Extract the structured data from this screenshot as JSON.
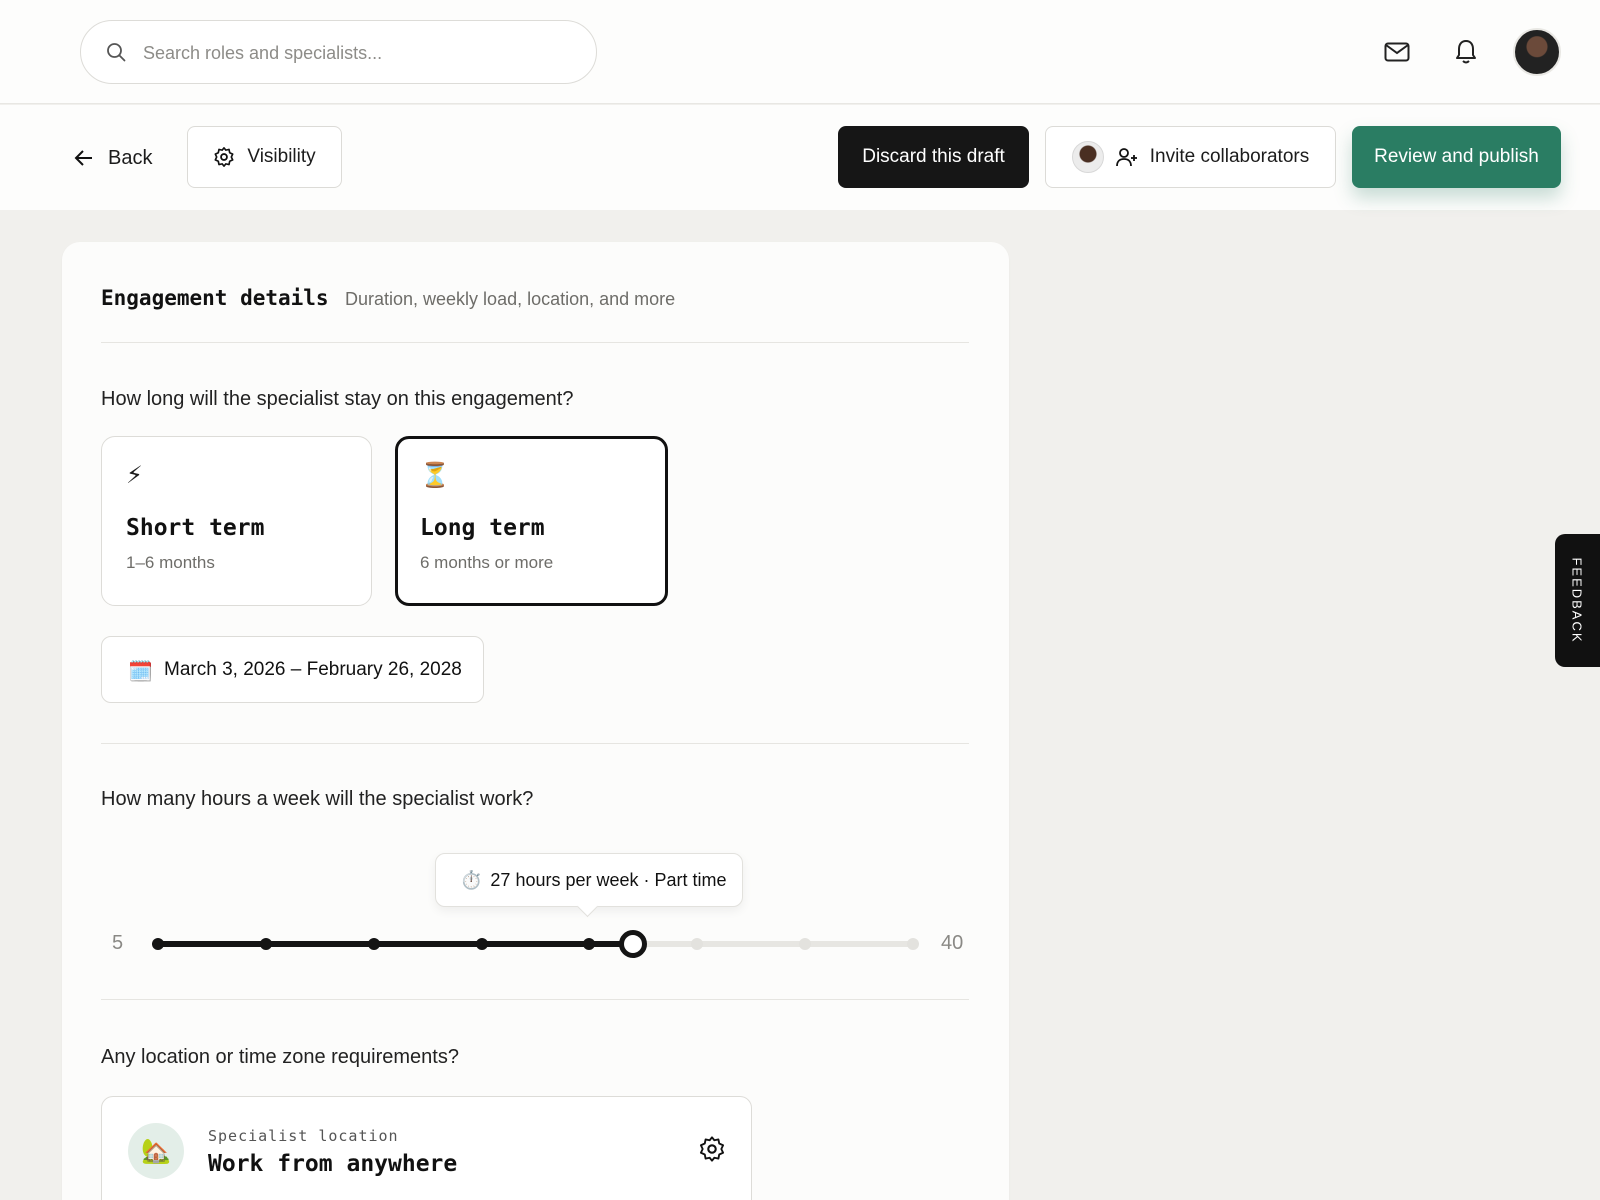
{
  "search": {
    "placeholder": "Search roles and specialists..."
  },
  "header": {
    "icons": [
      "mail-icon",
      "bell-icon",
      "user-avatar"
    ]
  },
  "actions": {
    "back_label": "Back",
    "visibility_label": "Visibility",
    "discard_label": "Discard this draft",
    "invite_label": "Invite collaborators",
    "publish_label": "Review and publish"
  },
  "engagement": {
    "title": "Engagement details",
    "subtitle": "Duration, weekly load, location, and more",
    "duration_question": "How long will the specialist stay on this engagement?",
    "options": [
      {
        "icon": "⚡",
        "title": "Short term",
        "desc": "1–6 months",
        "selected": false
      },
      {
        "icon": "⏳",
        "title": "Long term",
        "desc": "6 months or more",
        "selected": true
      }
    ],
    "date_icon": "🗓️",
    "date_range": "March 3, 2026 – February 26, 2028",
    "hours_question": "How many hours a week will the specialist work?",
    "hours_tooltip_icon": "⏱️",
    "hours_tooltip": "27 hours per week · Part time",
    "hours": {
      "min": 5,
      "max": 40,
      "value": 27,
      "min_label": "5",
      "max_label": "40"
    },
    "location_question": "Any location or time zone requirements?",
    "location_icon": "🏡",
    "location_label": "Specialist location",
    "location_value": "Work from anywhere"
  },
  "feedback_label": "FEEDBACK",
  "colors": {
    "accent": "#2a7d63",
    "dark": "#161616",
    "background": "#f1f0ed"
  }
}
